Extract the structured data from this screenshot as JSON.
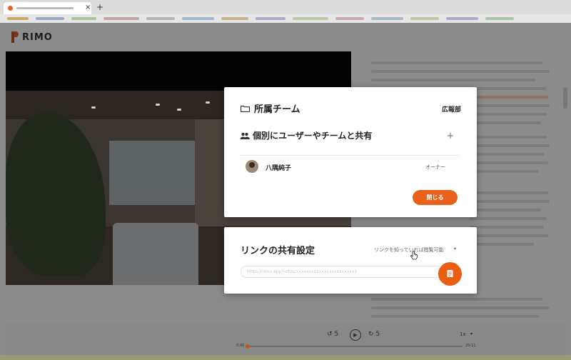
{
  "app": {
    "logo_text": "RIMO"
  },
  "browser": {
    "new_tab": "+",
    "close_tab": "×"
  },
  "share_modal": {
    "team_label": "所属チーム",
    "department": "広報部",
    "share_title": "個別にユーザーやチームと共有",
    "add_label": "+",
    "members": [
      {
        "name": "八隅純子",
        "role": "オーナー"
      }
    ],
    "close_label": "閉じる"
  },
  "link_modal": {
    "title": "リンクの共有設定",
    "permission": "リンクを知っていれば閲覧可能",
    "url_placeholder": "https://rimo.app/notes/xxxxxxxxxxxxxxxxxxxxxxxx"
  },
  "player": {
    "back_label": "5",
    "forward_label": "5",
    "speed": "1x",
    "current_time": "0:00",
    "duration": "25:11",
    "progress": 0.01
  },
  "colors": {
    "accent": "#e8621c",
    "logo": "#6a2e13"
  }
}
